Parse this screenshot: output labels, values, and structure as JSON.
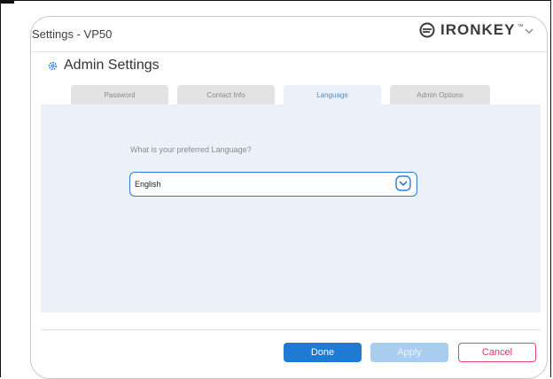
{
  "window": {
    "title": "Settings - VP50",
    "brand": "IRONKEY",
    "brand_tm": "™"
  },
  "section": {
    "title": "Admin Settings",
    "icon": "gear-icon"
  },
  "tabs": [
    {
      "label": "Password",
      "active": false
    },
    {
      "label": "Contact Info",
      "active": false
    },
    {
      "label": "Language",
      "active": true
    },
    {
      "label": "Admin Options",
      "active": false
    }
  ],
  "language": {
    "prompt": "What is your preferred Language?",
    "selected": "English"
  },
  "buttons": {
    "done": "Done",
    "apply": "Apply",
    "cancel": "Cancel"
  },
  "colors": {
    "accent": "#1f7bd1",
    "panel_background": "#eaf1f9",
    "cancel": "#e0466a",
    "apply_disabled": "#a9cdef"
  }
}
